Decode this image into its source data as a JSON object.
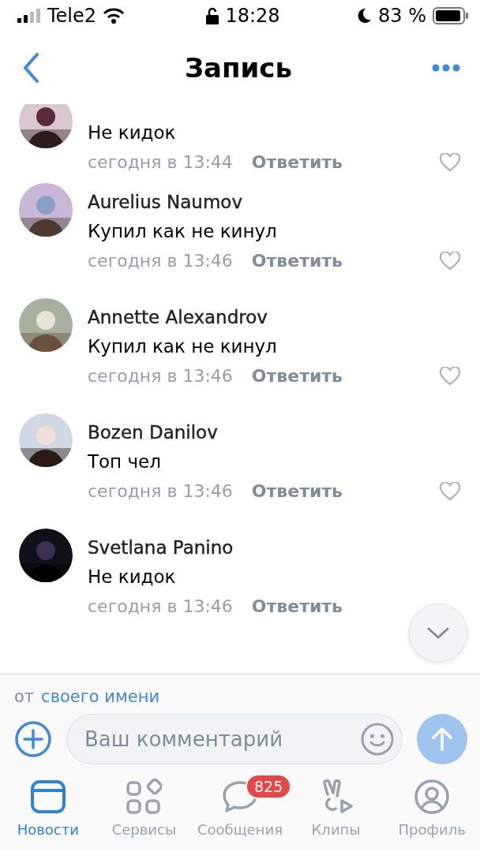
{
  "status_bar": {
    "carrier": "Tele2",
    "time": "18:28",
    "battery": "83 %"
  },
  "header": {
    "title": "Запись"
  },
  "comments": [
    {
      "text": "Не кидок",
      "time": "сегодня в 13:44",
      "reply": "Ответить",
      "liked": false
    },
    {
      "author": "Aurelius Naumov",
      "text": "Купил как не кинул",
      "time": "сегодня в 13:46",
      "reply": "Ответить",
      "liked": false
    },
    {
      "author": "Annette Alexandrov",
      "text": "Купил как не кинул",
      "time": "сегодня в 13:46",
      "reply": "Ответить",
      "liked": false
    },
    {
      "author": "Bozen Danilov",
      "text": "Топ чел",
      "time": "сегодня в 13:46",
      "reply": "Ответить",
      "liked": false
    },
    {
      "author": "Svetlana Panino",
      "text": "Не кидок",
      "time": "сегодня в 13:46",
      "reply": "Ответить"
    }
  ],
  "composer": {
    "from_prefix": "от",
    "from_link": "своего имени",
    "placeholder": "Ваш комментарий"
  },
  "tabs": [
    {
      "label": "Новости",
      "kind": "news",
      "selected": true
    },
    {
      "label": "Сервисы",
      "kind": "services",
      "selected": false
    },
    {
      "label": "Сообщения",
      "kind": "messages",
      "selected": false,
      "badge": "825"
    },
    {
      "label": "Клипы",
      "kind": "clips",
      "selected": false
    },
    {
      "label": "Профиль",
      "kind": "profile",
      "selected": false
    }
  ]
}
